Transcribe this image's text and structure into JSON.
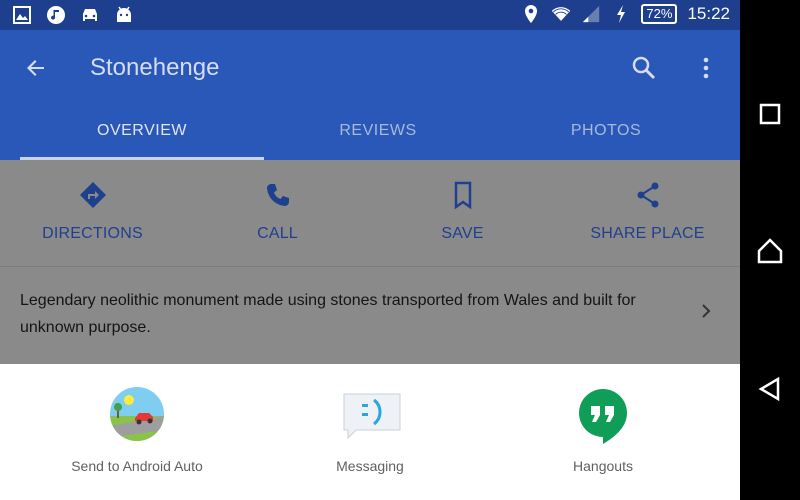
{
  "status_bar": {
    "battery": "72%",
    "time": "15:22"
  },
  "app_bar": {
    "title": "Stonehenge"
  },
  "tabs": [
    {
      "label": "OVERVIEW",
      "active": true
    },
    {
      "label": "REVIEWS",
      "active": false
    },
    {
      "label": "PHOTOS",
      "active": false
    }
  ],
  "actions": [
    {
      "label": "DIRECTIONS",
      "icon": "directions-icon"
    },
    {
      "label": "CALL",
      "icon": "phone-icon"
    },
    {
      "label": "SAVE",
      "icon": "bookmark-icon"
    },
    {
      "label": "SHARE PLACE",
      "icon": "share-icon"
    }
  ],
  "description": "Legendary neolithic monument made using stones transported from Wales and built for unknown purpose.",
  "share_sheet": {
    "targets": [
      {
        "label": "Send to Android Auto",
        "icon": "android-auto-icon"
      },
      {
        "label": "Messaging",
        "icon": "messaging-icon"
      },
      {
        "label": "Hangouts",
        "icon": "hangouts-icon"
      }
    ]
  },
  "colors": {
    "app_bar": "#2958b8",
    "status_bar": "#1d3f8e",
    "scrim": "#8a8a8a",
    "action_blue": "#1f3f8f",
    "hangouts_green": "#0f9d58"
  }
}
